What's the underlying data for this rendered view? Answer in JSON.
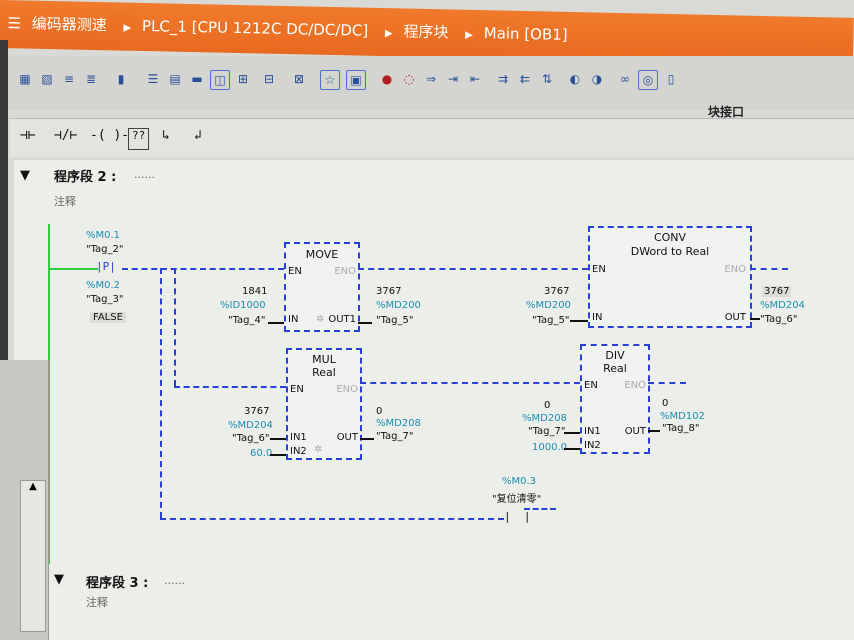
{
  "titlebar": {
    "project": "编码器测速",
    "device": "PLC_1 [CPU 1212C DC/DC/DC]",
    "folder": "程序块",
    "block": "Main [OB1]"
  },
  "toolbar": {
    "interface_label": "块接口"
  },
  "ladder_palette": {
    "no_contact": "⊣⊢",
    "nc_contact": "⊣/⊢",
    "coil": "-( )-",
    "empty_box": "??",
    "open_branch": "↳",
    "close_branch": "↲"
  },
  "network2": {
    "title": "程序段 2 :",
    "title_suffix": "......",
    "comment": "注释",
    "edge_contact": {
      "address": "%M0.1",
      "tag": "\"Tag_2\"",
      "symbol": "P"
    },
    "edge_bit": {
      "address": "%M0.2",
      "tag": "\"Tag_3\"",
      "value": "FALSE"
    },
    "move": {
      "title": "MOVE",
      "en": "EN",
      "eno": "ENO",
      "in": "IN",
      "out": "OUT1",
      "star": "✲",
      "in_value": "1841",
      "in_address": "%ID1000",
      "in_tag": "\"Tag_4\"",
      "out_value": "3767",
      "out_address": "%MD200",
      "out_tag": "\"Tag_5\""
    },
    "conv": {
      "title": "CONV",
      "subtitle": "DWord to Real",
      "en": "EN",
      "eno": "ENO",
      "in": "IN",
      "out": "OUT",
      "in_value": "3767",
      "in_address": "%MD200",
      "in_tag": "\"Tag_5\"",
      "out_value": "3767",
      "out_address": "%MD204",
      "out_tag": "\"Tag_6\""
    },
    "mul": {
      "title": "MUL",
      "subtitle": "Real",
      "en": "EN",
      "eno": "ENO",
      "in1": "IN1",
      "in2": "IN2",
      "out": "OUT",
      "star": "✲",
      "in1_value": "3767",
      "in1_address": "%MD204",
      "in1_tag": "\"Tag_6\"",
      "in2_const": "60.0",
      "out_value": "0",
      "out_address": "%MD208",
      "out_tag": "\"Tag_7\""
    },
    "div": {
      "title": "DIV",
      "subtitle": "Real",
      "en": "EN",
      "eno": "ENO",
      "in1": "IN1",
      "in2": "IN2",
      "out": "OUT",
      "in1_value": "0",
      "in1_address": "%MD208",
      "in1_tag": "\"Tag_7\"",
      "in2_const": "1000.0",
      "out_value": "0",
      "out_address": "%MD102",
      "out_tag": "\"Tag_8\""
    },
    "reset_contact": {
      "address": "%M0.3",
      "tag": "\"复位清零\""
    }
  },
  "network3": {
    "title": "程序段 3 :",
    "title_suffix": "......",
    "comment": "注释"
  },
  "colors": {
    "accent": "#e8691f",
    "wire_active": "#2a3fd6",
    "rail": "#2ecc40",
    "address": "#1a8fb0"
  }
}
